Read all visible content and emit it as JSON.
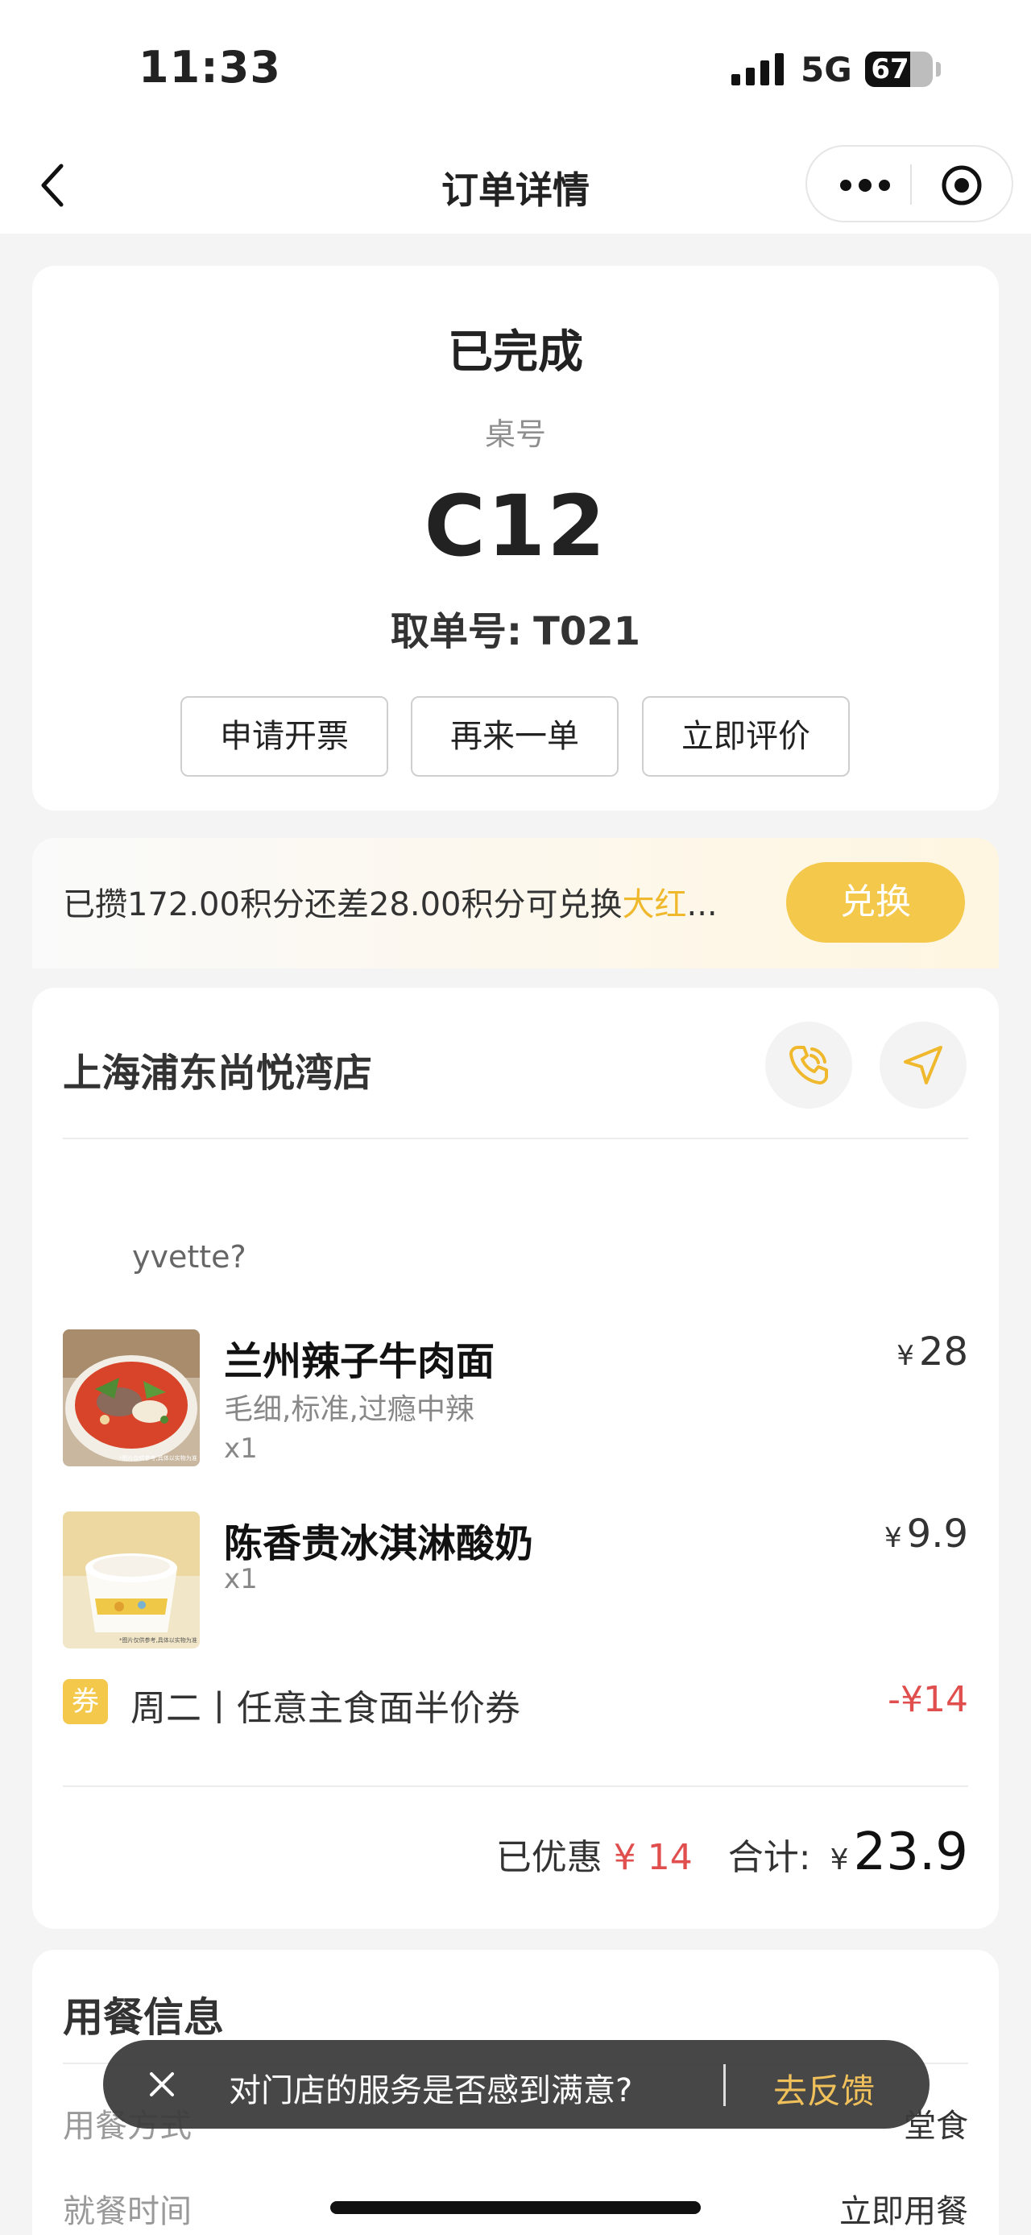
{
  "status_bar": {
    "time": "11:33",
    "network": "5G",
    "battery": "67",
    "battery_level": 0.67
  },
  "nav": {
    "title": "订单详情"
  },
  "order_status": {
    "title": "已完成",
    "table_label": "桌号",
    "table_number": "C12",
    "pickup_prefix": "取单号:",
    "pickup_number": "T021",
    "buttons": [
      "申请开票",
      "再来一单",
      "立即评价"
    ]
  },
  "points": {
    "text": "已攒172.00积分还差28.00积分可兑换",
    "highlight": "大红",
    "ellipsis": "...",
    "button": "兑换"
  },
  "store": {
    "name": "上海浦东尚悦湾店"
  },
  "customer": "yvette?",
  "items": [
    {
      "name": "兰州辣子牛肉面",
      "spec": "毛细,标准,过瘾中辣",
      "qty": "x1",
      "currency": "¥",
      "price": "28",
      "image_caption": "*图片仅供参考,具体以实物为准"
    },
    {
      "name": "陈香贵冰淇淋酸奶",
      "spec": "",
      "qty": "x1",
      "currency": "¥",
      "price": "9.9",
      "image_caption": "*图片仅供参考,具体以实物为准"
    }
  ],
  "coupon": {
    "tag": "券",
    "name": "周二丨任意主食面半价券",
    "amount": "-¥14"
  },
  "summary": {
    "discount_label": "已优惠",
    "discount_currency": "¥",
    "discount_value": "14",
    "total_label": "合计:",
    "total_currency": "¥",
    "total_value": "23.9"
  },
  "dining_info": {
    "title": "用餐信息",
    "rows": [
      {
        "label": "用餐方式",
        "value": "堂食"
      },
      {
        "label": "就餐时间",
        "value": "立即用餐"
      }
    ]
  },
  "toast": {
    "text": "对门店的服务是否感到满意?",
    "action": "去反馈"
  },
  "colors": {
    "accent": "#f4c84a",
    "price_red": "#e04e4e",
    "toast_action": "#f0c05a"
  }
}
